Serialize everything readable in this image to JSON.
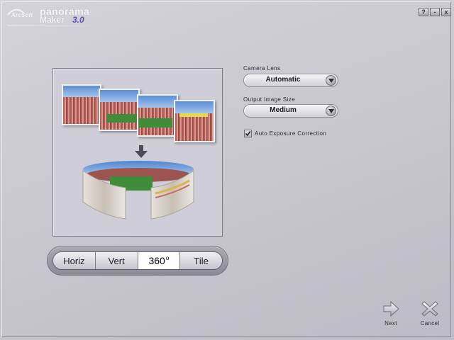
{
  "app": {
    "brand": "ArcSoft",
    "title_line1": "panorama",
    "title_line2": "Maker",
    "version": "3.0"
  },
  "window_buttons": [
    "?",
    "-",
    "x"
  ],
  "camera_lens": {
    "label": "Camera Lens",
    "value": "Automatic"
  },
  "output_size": {
    "label": "Output Image Size",
    "value": "Medium"
  },
  "auto_exposure": {
    "label": "Auto Exposure Correction",
    "checked": true
  },
  "layout_modes": [
    {
      "label": "Horiz",
      "active": false
    },
    {
      "label": "Vert",
      "active": false
    },
    {
      "label": "360",
      "sup": "o",
      "active": true
    },
    {
      "label": "Tile",
      "active": false
    }
  ],
  "buttons": {
    "next": "Next",
    "cancel": "Cancel"
  },
  "icons": {
    "window_help": "help-icon",
    "window_min": "minimize-icon",
    "window_close": "close-icon",
    "combo_arrow": "chevron-down-icon",
    "next": "arrow-right-icon",
    "cancel": "x-icon"
  }
}
